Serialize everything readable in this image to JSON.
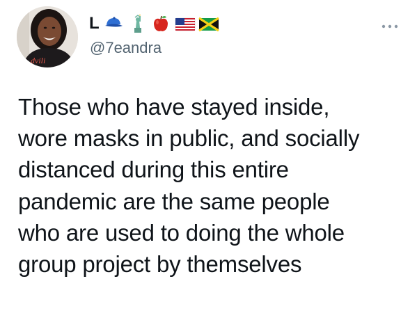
{
  "user": {
    "display_name": "L",
    "handle": "@7eandra",
    "name_emojis": [
      "blue-cap-emoji",
      "statue-of-liberty-emoji",
      "red-apple-emoji",
      "us-flag-emoji",
      "jamaica-flag-emoji"
    ],
    "avatar_shirt_text": "dvili"
  },
  "tweet": {
    "lines": [
      "Those who have stayed inside,",
      "wore masks in public, and socially",
      "distanced during this entire",
      "pandemic are the same people",
      "who are used to doing the whole",
      "group project by themselves"
    ]
  },
  "icons": {
    "more": "more-options-icon"
  },
  "colors": {
    "text": "#0f1419",
    "secondary": "#536471",
    "background": "#ffffff"
  }
}
